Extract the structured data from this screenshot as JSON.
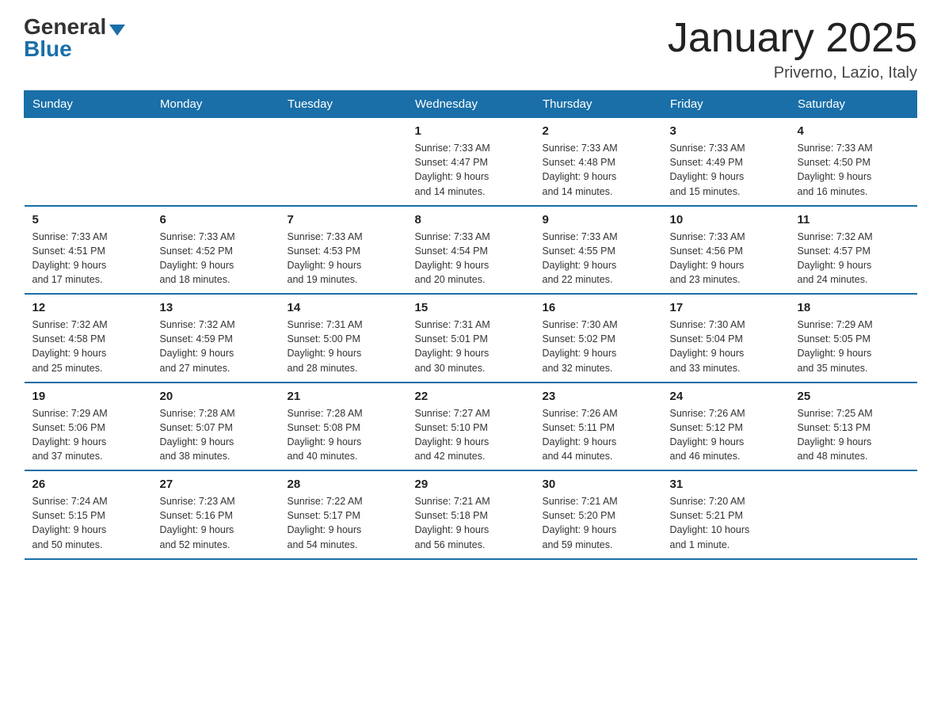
{
  "logo": {
    "general": "General",
    "blue": "Blue"
  },
  "title": "January 2025",
  "location": "Priverno, Lazio, Italy",
  "days_of_week": [
    "Sunday",
    "Monday",
    "Tuesday",
    "Wednesday",
    "Thursday",
    "Friday",
    "Saturday"
  ],
  "weeks": [
    [
      {
        "day": "",
        "info": ""
      },
      {
        "day": "",
        "info": ""
      },
      {
        "day": "",
        "info": ""
      },
      {
        "day": "1",
        "info": "Sunrise: 7:33 AM\nSunset: 4:47 PM\nDaylight: 9 hours\nand 14 minutes."
      },
      {
        "day": "2",
        "info": "Sunrise: 7:33 AM\nSunset: 4:48 PM\nDaylight: 9 hours\nand 14 minutes."
      },
      {
        "day": "3",
        "info": "Sunrise: 7:33 AM\nSunset: 4:49 PM\nDaylight: 9 hours\nand 15 minutes."
      },
      {
        "day": "4",
        "info": "Sunrise: 7:33 AM\nSunset: 4:50 PM\nDaylight: 9 hours\nand 16 minutes."
      }
    ],
    [
      {
        "day": "5",
        "info": "Sunrise: 7:33 AM\nSunset: 4:51 PM\nDaylight: 9 hours\nand 17 minutes."
      },
      {
        "day": "6",
        "info": "Sunrise: 7:33 AM\nSunset: 4:52 PM\nDaylight: 9 hours\nand 18 minutes."
      },
      {
        "day": "7",
        "info": "Sunrise: 7:33 AM\nSunset: 4:53 PM\nDaylight: 9 hours\nand 19 minutes."
      },
      {
        "day": "8",
        "info": "Sunrise: 7:33 AM\nSunset: 4:54 PM\nDaylight: 9 hours\nand 20 minutes."
      },
      {
        "day": "9",
        "info": "Sunrise: 7:33 AM\nSunset: 4:55 PM\nDaylight: 9 hours\nand 22 minutes."
      },
      {
        "day": "10",
        "info": "Sunrise: 7:33 AM\nSunset: 4:56 PM\nDaylight: 9 hours\nand 23 minutes."
      },
      {
        "day": "11",
        "info": "Sunrise: 7:32 AM\nSunset: 4:57 PM\nDaylight: 9 hours\nand 24 minutes."
      }
    ],
    [
      {
        "day": "12",
        "info": "Sunrise: 7:32 AM\nSunset: 4:58 PM\nDaylight: 9 hours\nand 25 minutes."
      },
      {
        "day": "13",
        "info": "Sunrise: 7:32 AM\nSunset: 4:59 PM\nDaylight: 9 hours\nand 27 minutes."
      },
      {
        "day": "14",
        "info": "Sunrise: 7:31 AM\nSunset: 5:00 PM\nDaylight: 9 hours\nand 28 minutes."
      },
      {
        "day": "15",
        "info": "Sunrise: 7:31 AM\nSunset: 5:01 PM\nDaylight: 9 hours\nand 30 minutes."
      },
      {
        "day": "16",
        "info": "Sunrise: 7:30 AM\nSunset: 5:02 PM\nDaylight: 9 hours\nand 32 minutes."
      },
      {
        "day": "17",
        "info": "Sunrise: 7:30 AM\nSunset: 5:04 PM\nDaylight: 9 hours\nand 33 minutes."
      },
      {
        "day": "18",
        "info": "Sunrise: 7:29 AM\nSunset: 5:05 PM\nDaylight: 9 hours\nand 35 minutes."
      }
    ],
    [
      {
        "day": "19",
        "info": "Sunrise: 7:29 AM\nSunset: 5:06 PM\nDaylight: 9 hours\nand 37 minutes."
      },
      {
        "day": "20",
        "info": "Sunrise: 7:28 AM\nSunset: 5:07 PM\nDaylight: 9 hours\nand 38 minutes."
      },
      {
        "day": "21",
        "info": "Sunrise: 7:28 AM\nSunset: 5:08 PM\nDaylight: 9 hours\nand 40 minutes."
      },
      {
        "day": "22",
        "info": "Sunrise: 7:27 AM\nSunset: 5:10 PM\nDaylight: 9 hours\nand 42 minutes."
      },
      {
        "day": "23",
        "info": "Sunrise: 7:26 AM\nSunset: 5:11 PM\nDaylight: 9 hours\nand 44 minutes."
      },
      {
        "day": "24",
        "info": "Sunrise: 7:26 AM\nSunset: 5:12 PM\nDaylight: 9 hours\nand 46 minutes."
      },
      {
        "day": "25",
        "info": "Sunrise: 7:25 AM\nSunset: 5:13 PM\nDaylight: 9 hours\nand 48 minutes."
      }
    ],
    [
      {
        "day": "26",
        "info": "Sunrise: 7:24 AM\nSunset: 5:15 PM\nDaylight: 9 hours\nand 50 minutes."
      },
      {
        "day": "27",
        "info": "Sunrise: 7:23 AM\nSunset: 5:16 PM\nDaylight: 9 hours\nand 52 minutes."
      },
      {
        "day": "28",
        "info": "Sunrise: 7:22 AM\nSunset: 5:17 PM\nDaylight: 9 hours\nand 54 minutes."
      },
      {
        "day": "29",
        "info": "Sunrise: 7:21 AM\nSunset: 5:18 PM\nDaylight: 9 hours\nand 56 minutes."
      },
      {
        "day": "30",
        "info": "Sunrise: 7:21 AM\nSunset: 5:20 PM\nDaylight: 9 hours\nand 59 minutes."
      },
      {
        "day": "31",
        "info": "Sunrise: 7:20 AM\nSunset: 5:21 PM\nDaylight: 10 hours\nand 1 minute."
      },
      {
        "day": "",
        "info": ""
      }
    ]
  ]
}
